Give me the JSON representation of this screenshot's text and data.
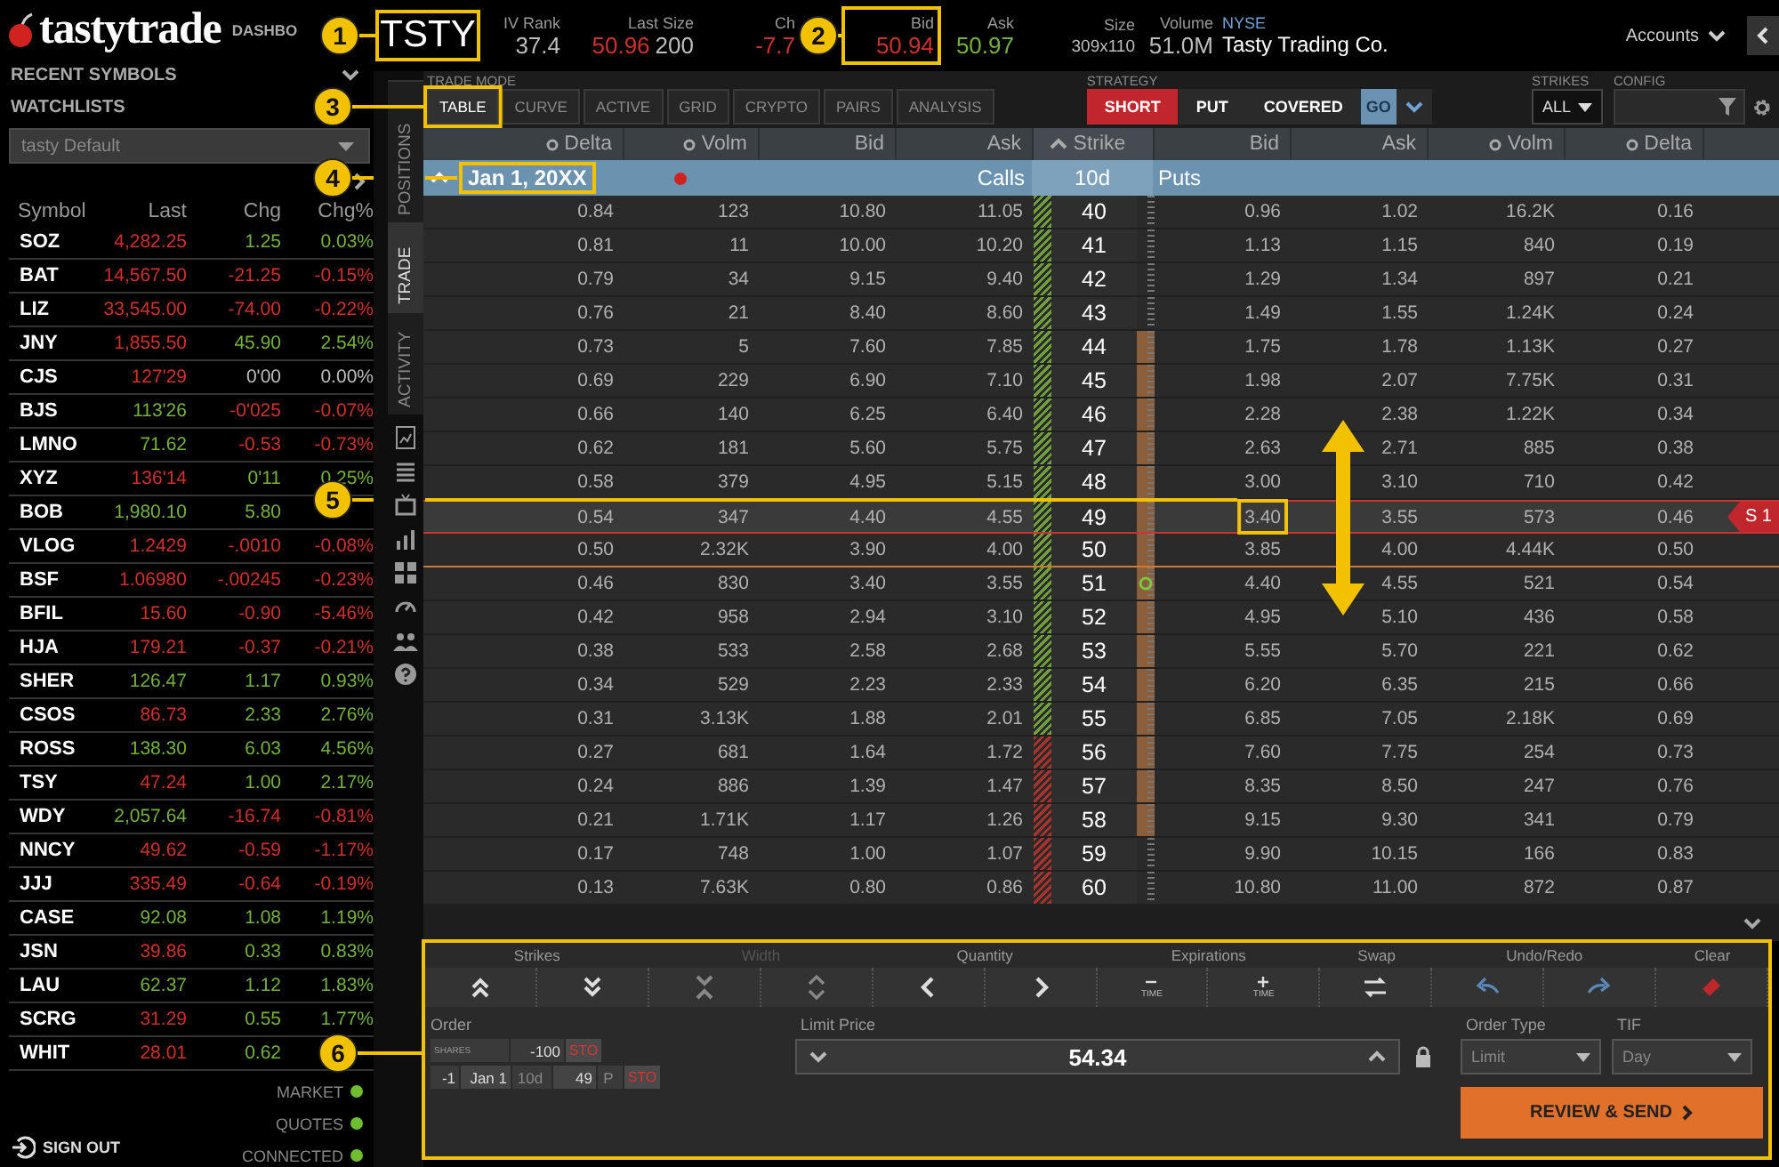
{
  "header": {
    "logo": "tastytrade",
    "dashboard": "DASHBO"
  },
  "sidebar": {
    "recent_symbols": "RECENT SYMBOLS",
    "watchlists": "WATCHLISTS",
    "watchlist": "tasty Default",
    "columns": [
      "Symbol",
      "Last",
      "Chg",
      "Chg%"
    ],
    "rows": [
      {
        "symbol": "SOZ",
        "last": {
          "text": "4,282.25",
          "color": "#d0302a"
        },
        "chg": {
          "text": "1.25",
          "color": "#74b33a"
        },
        "chg_pct": {
          "text": "0.03%",
          "color": "#74b33a"
        }
      },
      {
        "symbol": "BAT",
        "last": {
          "text": "14,567.50",
          "color": "#d0302a"
        },
        "chg": {
          "text": "-21.25",
          "color": "#d0302a"
        },
        "chg_pct": {
          "text": "-0.15%",
          "color": "#d0302a"
        }
      },
      {
        "symbol": "LIZ",
        "last": {
          "text": "33,545.00",
          "color": "#d0302a"
        },
        "chg": {
          "text": "-74.00",
          "color": "#d0302a"
        },
        "chg_pct": {
          "text": "-0.22%",
          "color": "#d0302a"
        }
      },
      {
        "symbol": "JNY",
        "last": {
          "text": "1,855.50",
          "color": "#d0302a"
        },
        "chg": {
          "text": "45.90",
          "color": "#74b33a"
        },
        "chg_pct": {
          "text": "2.54%",
          "color": "#74b33a"
        }
      },
      {
        "symbol": "CJS",
        "last": {
          "text": "127'29",
          "color": "#d0302a"
        },
        "chg": {
          "text": "0'00",
          "color": "#bdbdbd"
        },
        "chg_pct": {
          "text": "0.00%",
          "color": "#bdbdbd"
        }
      },
      {
        "symbol": "BJS",
        "last": {
          "text": "113'26",
          "color": "#74b33a"
        },
        "chg": {
          "text": "-0'025",
          "color": "#d0302a"
        },
        "chg_pct": {
          "text": "-0.07%",
          "color": "#d0302a"
        }
      },
      {
        "symbol": "LMNO",
        "last": {
          "text": "71.62",
          "color": "#74b33a"
        },
        "chg": {
          "text": "-0.53",
          "color": "#d0302a"
        },
        "chg_pct": {
          "text": "-0.73%",
          "color": "#d0302a"
        }
      },
      {
        "symbol": "XYZ",
        "last": {
          "text": "136'14",
          "color": "#d0302a"
        },
        "chg": {
          "text": "0'11",
          "color": "#74b33a"
        },
        "chg_pct": {
          "text": "0.25%",
          "color": "#74b33a"
        }
      },
      {
        "symbol": "BOB",
        "last": {
          "text": "1,980.10",
          "color": "#74b33a"
        },
        "chg": {
          "text": "5.80",
          "color": "#74b33a"
        }
      },
      {
        "symbol": "VLOG",
        "last": {
          "text": "1.2429",
          "color": "#d0302a"
        },
        "chg": {
          "text": "-.0010",
          "color": "#d0302a"
        },
        "chg_pct": {
          "text": "-0.08%",
          "color": "#d0302a"
        }
      },
      {
        "symbol": "BSF",
        "last": {
          "text": "1.06980",
          "color": "#d0302a"
        },
        "chg": {
          "text": "-.00245",
          "color": "#d0302a"
        },
        "chg_pct": {
          "text": "-0.23%",
          "color": "#d0302a"
        }
      },
      {
        "symbol": "BFIL",
        "last": {
          "text": "15.60",
          "color": "#d0302a"
        },
        "chg": {
          "text": "-0.90",
          "color": "#d0302a"
        },
        "chg_pct": {
          "text": "-5.46%",
          "color": "#d0302a"
        }
      },
      {
        "symbol": "HJA",
        "last": {
          "text": "179.21",
          "color": "#d0302a"
        },
        "chg": {
          "text": "-0.37",
          "color": "#d0302a"
        },
        "chg_pct": {
          "text": "-0.21%",
          "color": "#d0302a"
        }
      },
      {
        "symbol": "SHER",
        "last": {
          "text": "126.47",
          "color": "#74b33a"
        },
        "chg": {
          "text": "1.17",
          "color": "#74b33a"
        },
        "chg_pct": {
          "text": "0.93%",
          "color": "#74b33a"
        }
      },
      {
        "symbol": "CSOS",
        "last": {
          "text": "86.73",
          "color": "#d0302a"
        },
        "chg": {
          "text": "2.33",
          "color": "#74b33a"
        },
        "chg_pct": {
          "text": "2.76%",
          "color": "#74b33a"
        }
      },
      {
        "symbol": "ROSS",
        "last": {
          "text": "138.30",
          "color": "#74b33a"
        },
        "chg": {
          "text": "6.03",
          "color": "#74b33a"
        },
        "chg_pct": {
          "text": "4.56%",
          "color": "#74b33a"
        }
      },
      {
        "symbol": "TSY",
        "last": {
          "text": "47.24",
          "color": "#d0302a"
        },
        "chg": {
          "text": "1.00",
          "color": "#74b33a"
        },
        "chg_pct": {
          "text": "2.17%",
          "color": "#74b33a"
        }
      },
      {
        "symbol": "WDY",
        "last": {
          "text": "2,057.64",
          "color": "#74b33a"
        },
        "chg": {
          "text": "-16.74",
          "color": "#d0302a"
        },
        "chg_pct": {
          "text": "-0.81%",
          "color": "#d0302a"
        }
      },
      {
        "symbol": "NNCY",
        "last": {
          "text": "49.62",
          "color": "#d0302a"
        },
        "chg": {
          "text": "-0.59",
          "color": "#d0302a"
        },
        "chg_pct": {
          "text": "-1.17%",
          "color": "#d0302a"
        }
      },
      {
        "symbol": "JJJ",
        "last": {
          "text": "335.49",
          "color": "#d0302a"
        },
        "chg": {
          "text": "-0.64",
          "color": "#d0302a"
        },
        "chg_pct": {
          "text": "-0.19%",
          "color": "#d0302a"
        }
      },
      {
        "symbol": "CASE",
        "last": {
          "text": "92.08",
          "color": "#74b33a"
        },
        "chg": {
          "text": "1.08",
          "color": "#74b33a"
        },
        "chg_pct": {
          "text": "1.19%",
          "color": "#74b33a"
        }
      },
      {
        "symbol": "JSN",
        "last": {
          "text": "39.86",
          "color": "#d0302a"
        },
        "chg": {
          "text": "0.33",
          "color": "#74b33a"
        },
        "chg_pct": {
          "text": "0.83%",
          "color": "#74b33a"
        }
      },
      {
        "symbol": "LAU",
        "last": {
          "text": "62.37",
          "color": "#74b33a"
        },
        "chg": {
          "text": "1.12",
          "color": "#74b33a"
        },
        "chg_pct": {
          "text": "1.83%",
          "color": "#74b33a"
        }
      },
      {
        "symbol": "SCRG",
        "last": {
          "text": "31.29",
          "color": "#d0302a"
        },
        "chg": {
          "text": "0.55",
          "color": "#74b33a"
        },
        "chg_pct": {
          "text": "1.77%",
          "color": "#74b33a"
        }
      },
      {
        "symbol": "WHIT",
        "last": {
          "text": "28.01",
          "color": "#d0302a"
        },
        "chg": {
          "text": "0.62",
          "color": "#74b33a"
        }
      }
    ],
    "status": [
      {
        "label": "MARKET",
        "on": true
      },
      {
        "label": "QUOTES",
        "on": true
      },
      {
        "label": "CONNECTED",
        "on": true
      }
    ],
    "sign_out": "SIGN OUT"
  },
  "quote": {
    "symbol": "TSTY",
    "stats": [
      {
        "label": "IV Rank",
        "values": [
          {
            "text": "37.4",
            "color": "#bdbdbd"
          }
        ]
      },
      {
        "label": "Last Size",
        "values": [
          {
            "text": "50.96",
            "color": "#d0302a"
          },
          {
            "text": "200",
            "color": "#bdbdbd"
          }
        ]
      },
      {
        "label": "Ch",
        "values": [
          {
            "text": "-7.7",
            "color": "#d0302a"
          }
        ]
      },
      {
        "label": "Bid",
        "values": [
          {
            "text": "50.94",
            "color": "#d0302a"
          }
        ]
      },
      {
        "label": "Ask",
        "values": [
          {
            "text": "50.97",
            "color": "#74b33a"
          }
        ]
      },
      {
        "label": "Size",
        "values": [
          {
            "text": "309x110",
            "color": "#bdbdbd"
          }
        ]
      },
      {
        "label": "Volume",
        "values": [
          {
            "text": "51.0M",
            "color": "#bdbdbd"
          }
        ]
      }
    ],
    "exchange": "NYSE",
    "company": "Tasty Trading Co.",
    "accounts": "Accounts"
  },
  "tabs": [
    {
      "label": "POSITIONS",
      "selected": false
    },
    {
      "label": "TRADE",
      "selected": true
    },
    {
      "label": "ACTIVITY",
      "selected": false
    }
  ],
  "toolbar": {
    "trade_mode": {
      "label": "TRADE MODE",
      "options": [
        {
          "label": "TABLE",
          "selected": true
        },
        {
          "label": "CURVE",
          "selected": false
        },
        {
          "label": "ACTIVE",
          "selected": false
        },
        {
          "label": "GRID",
          "selected": false
        },
        {
          "label": "CRYPTO",
          "selected": false
        },
        {
          "label": "PAIRS",
          "selected": false
        },
        {
          "label": "ANALYSIS",
          "selected": false
        }
      ]
    },
    "strategy": {
      "label": "STRATEGY",
      "options": [
        {
          "label": "SHORT",
          "selected": true
        },
        {
          "label": "PUT",
          "selected": false
        },
        {
          "label": "COVERED",
          "selected": false
        }
      ],
      "go": "GO"
    },
    "strikes": {
      "label": "STRIKES",
      "value": "ALL"
    },
    "config": {
      "label": "CONFIG"
    }
  },
  "chain": {
    "columns": [
      {
        "label": "Delta",
        "kind": "toggle"
      },
      {
        "label": "Volm",
        "kind": "toggle"
      },
      {
        "label": "Bid",
        "kind": "plain"
      },
      {
        "label": "Ask",
        "kind": "plain"
      },
      {
        "label": "Strike",
        "kind": "sorted"
      },
      {
        "label": "Bid",
        "kind": "plain"
      },
      {
        "label": "Ask",
        "kind": "plain"
      },
      {
        "label": "Volm",
        "kind": "toggle"
      },
      {
        "label": "Delta",
        "kind": "toggle"
      }
    ],
    "expiration": {
      "date": "Jan 1, 20XX",
      "expanded": true,
      "calls": "Calls",
      "days": "10d",
      "puts": "Puts"
    },
    "rows": [
      {
        "strike": "40",
        "call": [
          "0.84",
          "123",
          "10.80",
          "11.05"
        ],
        "put": [
          "0.96",
          "1.02",
          "16.2K",
          "0.16"
        ],
        "color": "#6f9e3c",
        "in_range": false,
        "selected": false,
        "itm_line_after": false,
        "price_marker": false
      },
      {
        "strike": "41",
        "call": [
          "0.81",
          "11",
          "10.00",
          "10.20"
        ],
        "put": [
          "1.13",
          "1.15",
          "840",
          "0.19"
        ],
        "color": "#6f9e3c",
        "in_range": false,
        "selected": false,
        "itm_line_after": false,
        "price_marker": false
      },
      {
        "strike": "42",
        "call": [
          "0.79",
          "34",
          "9.15",
          "9.40"
        ],
        "put": [
          "1.29",
          "1.34",
          "897",
          "0.21"
        ],
        "color": "#6f9e3c",
        "in_range": false,
        "selected": false,
        "itm_line_after": false,
        "price_marker": false
      },
      {
        "strike": "43",
        "call": [
          "0.76",
          "21",
          "8.40",
          "8.60"
        ],
        "put": [
          "1.49",
          "1.55",
          "1.24K",
          "0.24"
        ],
        "color": "#6f9e3c",
        "in_range": false,
        "selected": false,
        "itm_line_after": false,
        "price_marker": false
      },
      {
        "strike": "44",
        "call": [
          "0.73",
          "5",
          "7.60",
          "7.85"
        ],
        "put": [
          "1.75",
          "1.78",
          "1.13K",
          "0.27"
        ],
        "color": "#6f9e3c",
        "in_range": true,
        "selected": false,
        "itm_line_after": false,
        "price_marker": false
      },
      {
        "strike": "45",
        "call": [
          "0.69",
          "229",
          "6.90",
          "7.10"
        ],
        "put": [
          "1.98",
          "2.07",
          "7.75K",
          "0.31"
        ],
        "color": "#6f9e3c",
        "in_range": true,
        "selected": false,
        "itm_line_after": false,
        "price_marker": false
      },
      {
        "strike": "46",
        "call": [
          "0.66",
          "140",
          "6.25",
          "6.40"
        ],
        "put": [
          "2.28",
          "2.38",
          "1.22K",
          "0.34"
        ],
        "color": "#6f9e3c",
        "in_range": true,
        "selected": false,
        "itm_line_after": false,
        "price_marker": false
      },
      {
        "strike": "47",
        "call": [
          "0.62",
          "181",
          "5.60",
          "5.75"
        ],
        "put": [
          "2.63",
          "2.71",
          "885",
          "0.38"
        ],
        "color": "#6f9e3c",
        "in_range": true,
        "selected": false,
        "itm_line_after": false,
        "price_marker": false
      },
      {
        "strike": "48",
        "call": [
          "0.58",
          "379",
          "4.95",
          "5.15"
        ],
        "put": [
          "3.00",
          "3.10",
          "710",
          "0.42"
        ],
        "color": "#6f9e3c",
        "in_range": true,
        "selected": false,
        "itm_line_after": false,
        "price_marker": false
      },
      {
        "strike": "49",
        "call": [
          "0.54",
          "347",
          "4.40",
          "4.55"
        ],
        "put": [
          "3.40",
          "3.55",
          "573",
          "0.46"
        ],
        "color": "#6f9e3c",
        "in_range": true,
        "selected": true,
        "itm_line_after": false,
        "price_marker": false,
        "tag": "S 1"
      },
      {
        "strike": "50",
        "call": [
          "0.50",
          "2.32K",
          "3.90",
          "4.00"
        ],
        "put": [
          "3.85",
          "4.00",
          "4.44K",
          "0.50"
        ],
        "color": "#6f9e3c",
        "in_range": true,
        "selected": false,
        "itm_line_after": true,
        "price_marker": false
      },
      {
        "strike": "51",
        "call": [
          "0.46",
          "830",
          "3.40",
          "3.55"
        ],
        "put": [
          "4.40",
          "4.55",
          "521",
          "0.54"
        ],
        "color": "#6f9e3c",
        "in_range": true,
        "selected": false,
        "itm_line_after": false,
        "price_marker": true
      },
      {
        "strike": "52",
        "call": [
          "0.42",
          "958",
          "2.94",
          "3.10"
        ],
        "put": [
          "4.95",
          "5.10",
          "436",
          "0.58"
        ],
        "color": "#6f9e3c",
        "in_range": true,
        "selected": false,
        "itm_line_after": false,
        "price_marker": false
      },
      {
        "strike": "53",
        "call": [
          "0.38",
          "533",
          "2.58",
          "2.68"
        ],
        "put": [
          "5.55",
          "5.70",
          "221",
          "0.62"
        ],
        "color": "#6f9e3c",
        "in_range": true,
        "selected": false,
        "itm_line_after": false,
        "price_marker": false
      },
      {
        "strike": "54",
        "call": [
          "0.34",
          "529",
          "2.23",
          "2.33"
        ],
        "put": [
          "6.20",
          "6.35",
          "215",
          "0.66"
        ],
        "color": "#6f9e3c",
        "in_range": true,
        "selected": false,
        "itm_line_after": false,
        "price_marker": false
      },
      {
        "strike": "55",
        "call": [
          "0.31",
          "3.13K",
          "1.88",
          "2.01"
        ],
        "put": [
          "6.85",
          "7.05",
          "2.18K",
          "0.69"
        ],
        "color": "#6f9e3c",
        "in_range": true,
        "selected": false,
        "itm_line_after": false,
        "price_marker": false
      },
      {
        "strike": "56",
        "call": [
          "0.27",
          "681",
          "1.64",
          "1.72"
        ],
        "put": [
          "7.60",
          "7.75",
          "254",
          "0.73"
        ],
        "color": "#a8322c",
        "in_range": true,
        "selected": false,
        "itm_line_after": false,
        "price_marker": false
      },
      {
        "strike": "57",
        "call": [
          "0.24",
          "886",
          "1.39",
          "1.47"
        ],
        "put": [
          "8.35",
          "8.50",
          "247",
          "0.76"
        ],
        "color": "#a8322c",
        "in_range": true,
        "selected": false,
        "itm_line_after": false,
        "price_marker": false
      },
      {
        "strike": "58",
        "call": [
          "0.21",
          "1.71K",
          "1.17",
          "1.26"
        ],
        "put": [
          "9.15",
          "9.30",
          "341",
          "0.79"
        ],
        "color": "#a8322c",
        "in_range": true,
        "selected": false,
        "itm_line_after": false,
        "price_marker": false
      },
      {
        "strike": "59",
        "call": [
          "0.17",
          "748",
          "1.00",
          "1.07"
        ],
        "put": [
          "9.90",
          "10.15",
          "166",
          "0.83"
        ],
        "color": "#a8322c",
        "in_range": false,
        "selected": false,
        "itm_line_after": false,
        "price_marker": false
      },
      {
        "strike": "60",
        "call": [
          "0.13",
          "7.63K",
          "0.80",
          "0.86"
        ],
        "put": [
          "10.80",
          "11.00",
          "872",
          "0.87"
        ],
        "color": "#a8322c",
        "in_range": false,
        "selected": false,
        "itm_line_after": false,
        "price_marker": false
      }
    ]
  },
  "order": {
    "groups": [
      {
        "label": "Strikes",
        "disabled": false,
        "buttons": [
          {
            "kind": "double_up"
          },
          {
            "kind": "double_down"
          }
        ]
      },
      {
        "label": "Width",
        "disabled": true,
        "buttons": [
          {
            "kind": "narrow"
          },
          {
            "kind": "widen"
          }
        ]
      },
      {
        "label": "Quantity",
        "disabled": false,
        "buttons": [
          {
            "kind": "left"
          },
          {
            "kind": "right"
          }
        ]
      },
      {
        "label": "Expirations",
        "disabled": false,
        "buttons": [
          {
            "kind": "minus_time",
            "caption": "TIME"
          },
          {
            "kind": "plus_time",
            "caption": "TIME"
          }
        ]
      },
      {
        "label": "Swap",
        "disabled": false,
        "buttons": [
          {
            "kind": "swap"
          }
        ]
      },
      {
        "label": "Undo/Redo",
        "disabled": false,
        "buttons": [
          {
            "kind": "undo"
          },
          {
            "kind": "redo"
          }
        ]
      },
      {
        "label": "Clear",
        "disabled": false,
        "buttons": [
          {
            "kind": "clear"
          }
        ]
      }
    ],
    "order_label": "Order",
    "legs": [
      {
        "kind": "stock",
        "type": "SHARES",
        "qty": "-100",
        "action": "STO"
      },
      {
        "kind": "option",
        "qty": "-1",
        "expiration": "Jan 1",
        "days": "10d",
        "strike": "49",
        "type": "P",
        "action": "STO"
      }
    ],
    "limit_label": "Limit Price",
    "limit_price": "54.34",
    "order_type_label": "Order Type",
    "order_type": "Limit",
    "tif_label": "TIF",
    "tif": "Day",
    "submit": "REVIEW & SEND"
  },
  "callouts": [
    {
      "number": "1"
    },
    {
      "number": "2"
    },
    {
      "number": "3"
    },
    {
      "number": "4"
    },
    {
      "number": "5"
    },
    {
      "number": "6"
    }
  ]
}
